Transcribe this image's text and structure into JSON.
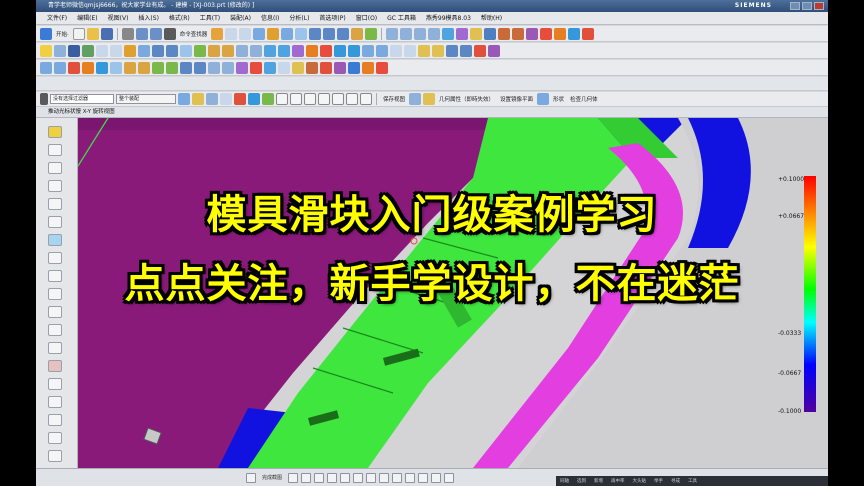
{
  "window": {
    "title": "青学老师微信qmjsj6666，祝大家学业有成。 - 建模 - [XJ-003.prt  (修改的) ]",
    "brand": "SIEMENS"
  },
  "menu": [
    "文件(F)",
    "编辑(E)",
    "视图(V)",
    "插入(S)",
    "格式(R)",
    "工具(T)",
    "装配(A)",
    "信息(I)",
    "分析(L)",
    "首选项(P)",
    "窗口(O)",
    "GC 工具箱",
    "燕秀99模具8.03",
    "帮助(H)"
  ],
  "toolbar1": {
    "start_label": "开始·",
    "command_finder": "命令查找器"
  },
  "filter": {
    "selection_filter": "没有选择过滤器",
    "assembly_scope": "整个装配"
  },
  "toolbar4": {
    "save_view": "保存视图",
    "geometry_props": "几何属性（即時失效）",
    "mirror_plane": "设置镜像平面",
    "shape": "形状",
    "check_geometry": "检查几何体"
  },
  "resource_bar": {
    "label": "推动光标状慢 X-Y 旋转视图"
  },
  "legend": {
    "labels": [
      "+0.1000",
      "+0.0667",
      "-0.0333",
      "-0.0667",
      "-0.1000"
    ]
  },
  "statusbar": {
    "text": "完成截图"
  },
  "taskbar": [
    "同轴",
    "选到",
    "新增",
    "再中率",
    "大头贴",
    "举手",
    "寻成",
    "工具"
  ],
  "colors": {
    "purple_part": "#8a1a7a",
    "green_part": "#3ee63e",
    "blue_part": "#1212e0",
    "magenta_band": "#e23ee0",
    "caption": "#ffff00"
  },
  "overlay": {
    "line1": "模具滑块入门级案例学习",
    "line2": "点点关注，新手学设计，不在迷茫"
  }
}
